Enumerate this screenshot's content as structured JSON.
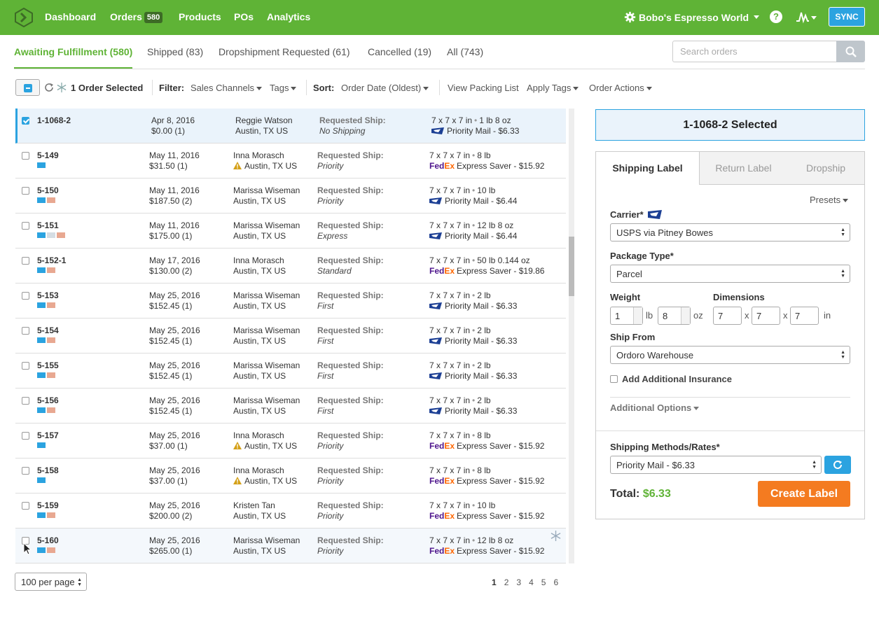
{
  "nav": {
    "items": [
      "Dashboard",
      "Orders",
      "Products",
      "POs",
      "Analytics"
    ],
    "orders_count": "580",
    "company": "Bobo's Espresso World",
    "help": "?",
    "sync": "SYNC"
  },
  "tabs": [
    "Awaiting Fulfillment (580)",
    "Shipped (83)",
    "Dropshipment Requested (61)",
    "Cancelled (19)",
    "All (743)"
  ],
  "search": {
    "placeholder": "Search orders"
  },
  "toolbar": {
    "selected": "1 Order Selected",
    "filter_label": "Filter:",
    "sales_channels": "Sales Channels",
    "tags": "Tags",
    "sort_label": "Sort:",
    "sort_value": "Order Date (Oldest)",
    "packing": "View Packing List",
    "apply_tags": "Apply Tags",
    "order_actions": "Order Actions"
  },
  "requested_ship_label": "Requested Ship:",
  "orders": [
    {
      "id": "1-1068-2",
      "date": "Apr 8, 2016",
      "amount": "$0.00 (1)",
      "name": "Reggie Watson",
      "loc": "Austin, TX US",
      "req": "No Shipping",
      "dims": "7 x 7 x 7 in",
      "weight": "1 lb 8 oz",
      "carrier": "usps",
      "rate": "Priority Mail - $6.33",
      "tags": []
    },
    {
      "id": "5-149",
      "date": "May 11, 2016",
      "amount": "$31.50 (1)",
      "name": "Inna Morasch",
      "loc": "Austin, TX US",
      "req": "Priority",
      "dims": "7 x 7 x 7 in",
      "weight": "8 lb",
      "carrier": "fedex",
      "rate": "Express Saver - $15.92",
      "tags": [
        "#2ba3e0"
      ],
      "warn": true
    },
    {
      "id": "5-150",
      "date": "May 11, 2016",
      "amount": "$187.50 (2)",
      "name": "Marissa Wiseman",
      "loc": "Austin, TX US",
      "req": "Priority",
      "dims": "7 x 7 x 7 in",
      "weight": "10 lb",
      "carrier": "usps",
      "rate": "Priority Mail - $6.44",
      "tags": [
        "#2ba3e0",
        "#e8a891"
      ]
    },
    {
      "id": "5-151",
      "date": "May 11, 2016",
      "amount": "$175.00 (1)",
      "name": "Marissa Wiseman",
      "loc": "Austin, TX US",
      "req": "Express",
      "dims": "7 x 7 x 7 in",
      "weight": "12 lb 8 oz",
      "carrier": "usps",
      "rate": "Priority Mail - $6.44",
      "tags": [
        "#2ba3e0",
        "#d5dde3",
        "#e8a891"
      ]
    },
    {
      "id": "5-152-1",
      "date": "May 17, 2016",
      "amount": "$130.00 (2)",
      "name": "Inna Morasch",
      "loc": "Austin, TX US",
      "req": "Standard",
      "dims": "7 x 7 x 7 in",
      "weight": "50 lb 0.144 oz",
      "carrier": "fedex",
      "rate": "Express Saver - $19.86",
      "tags": [
        "#2ba3e0",
        "#e8a891"
      ]
    },
    {
      "id": "5-153",
      "date": "May 25, 2016",
      "amount": "$152.45 (1)",
      "name": "Marissa Wiseman",
      "loc": "Austin, TX US",
      "req": "First",
      "dims": "7 x 7 x 7 in",
      "weight": "2 lb",
      "carrier": "usps",
      "rate": "Priority Mail - $6.33",
      "tags": [
        "#2ba3e0",
        "#e8a891"
      ]
    },
    {
      "id": "5-154",
      "date": "May 25, 2016",
      "amount": "$152.45 (1)",
      "name": "Marissa Wiseman",
      "loc": "Austin, TX US",
      "req": "First",
      "dims": "7 x 7 x 7 in",
      "weight": "2 lb",
      "carrier": "usps",
      "rate": "Priority Mail - $6.33",
      "tags": [
        "#2ba3e0",
        "#e8a891"
      ]
    },
    {
      "id": "5-155",
      "date": "May 25, 2016",
      "amount": "$152.45 (1)",
      "name": "Marissa Wiseman",
      "loc": "Austin, TX US",
      "req": "First",
      "dims": "7 x 7 x 7 in",
      "weight": "2 lb",
      "carrier": "usps",
      "rate": "Priority Mail - $6.33",
      "tags": [
        "#2ba3e0",
        "#e8a891"
      ]
    },
    {
      "id": "5-156",
      "date": "May 25, 2016",
      "amount": "$152.45 (1)",
      "name": "Marissa Wiseman",
      "loc": "Austin, TX US",
      "req": "First",
      "dims": "7 x 7 x 7 in",
      "weight": "2 lb",
      "carrier": "usps",
      "rate": "Priority Mail - $6.33",
      "tags": [
        "#2ba3e0",
        "#e8a891"
      ]
    },
    {
      "id": "5-157",
      "date": "May 25, 2016",
      "amount": "$37.00 (1)",
      "name": "Inna Morasch",
      "loc": "Austin, TX US",
      "req": "Priority",
      "dims": "7 x 7 x 7 in",
      "weight": "8 lb",
      "carrier": "fedex",
      "rate": "Express Saver - $15.92",
      "tags": [
        "#2ba3e0"
      ],
      "warn": true
    },
    {
      "id": "5-158",
      "date": "May 25, 2016",
      "amount": "$37.00 (1)",
      "name": "Inna Morasch",
      "loc": "Austin, TX US",
      "req": "Priority",
      "dims": "7 x 7 x 7 in",
      "weight": "8 lb",
      "carrier": "fedex",
      "rate": "Express Saver - $15.92",
      "tags": [
        "#2ba3e0"
      ],
      "warn": true
    },
    {
      "id": "5-159",
      "date": "May 25, 2016",
      "amount": "$200.00 (2)",
      "name": "Kristen Tan",
      "loc": "Austin, TX US",
      "req": "Priority",
      "dims": "7 x 7 x 7 in",
      "weight": "10 lb",
      "carrier": "fedex",
      "rate": "Express Saver - $15.92",
      "tags": [
        "#2ba3e0",
        "#e8a891"
      ]
    },
    {
      "id": "5-160",
      "date": "May 25, 2016",
      "amount": "$265.00 (1)",
      "name": "Marissa Wiseman",
      "loc": "Austin, TX US",
      "req": "Priority",
      "dims": "7 x 7 x 7 in",
      "weight": "12 lb 8 oz",
      "carrier": "fedex",
      "rate": "Express Saver - $15.92",
      "tags": [
        "#2ba3e0",
        "#e8a891"
      ]
    }
  ],
  "fedex": {
    "fe": "Fed",
    "ex": "Ex"
  },
  "pagination": {
    "per_page": "100 per page",
    "pages": [
      "1",
      "2",
      "3",
      "4",
      "5",
      "6"
    ]
  },
  "panel": {
    "selected_title": "1-1068-2 Selected",
    "tabs": [
      "Shipping Label",
      "Return Label",
      "Dropship"
    ],
    "presets": "Presets",
    "carrier_label": "Carrier*",
    "carrier_value": "USPS via Pitney Bowes",
    "package_label": "Package Type*",
    "package_value": "Parcel",
    "weight_label": "Weight",
    "weight_lb": "1",
    "weight_oz": "8",
    "lb": "lb",
    "oz": "oz",
    "dims_label": "Dimensions",
    "dim_l": "7",
    "dim_w": "7",
    "dim_h": "7",
    "x": "x",
    "in": "in",
    "shipfrom_label": "Ship From",
    "shipfrom_value": "Ordoro Warehouse",
    "insurance": "Add Additional Insurance",
    "additional": "Additional Options",
    "methods_label": "Shipping Methods/Rates*",
    "method_value": "Priority Mail - $6.33",
    "total_label": "Total:",
    "total_value": "$6.33",
    "create": "Create Label"
  },
  "colors": {
    "brand_green": "#5fb336",
    "accent_blue": "#2ba3e0",
    "cta_orange": "#f47b20"
  }
}
